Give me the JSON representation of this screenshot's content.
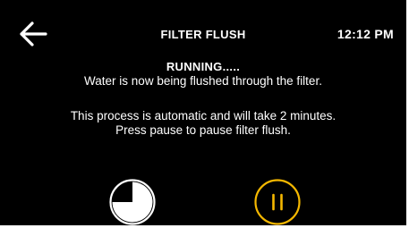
{
  "header": {
    "back_icon": "arrow-left-icon",
    "title": "FILTER FLUSH",
    "time": "12:12 PM"
  },
  "main": {
    "status": "RUNNING.....",
    "line1": "Water is now being flushed through the filter.",
    "line2": "This process is automatic and will take 2 minutes.",
    "line3": "Press pause to pause filter flush."
  },
  "controls": {
    "progress_icon": "progress-timer-icon",
    "progress_fraction": 0.75,
    "pause_icon": "pause-icon"
  },
  "colors": {
    "background": "#000000",
    "text": "#ffffff",
    "accent": "#f5b800"
  }
}
